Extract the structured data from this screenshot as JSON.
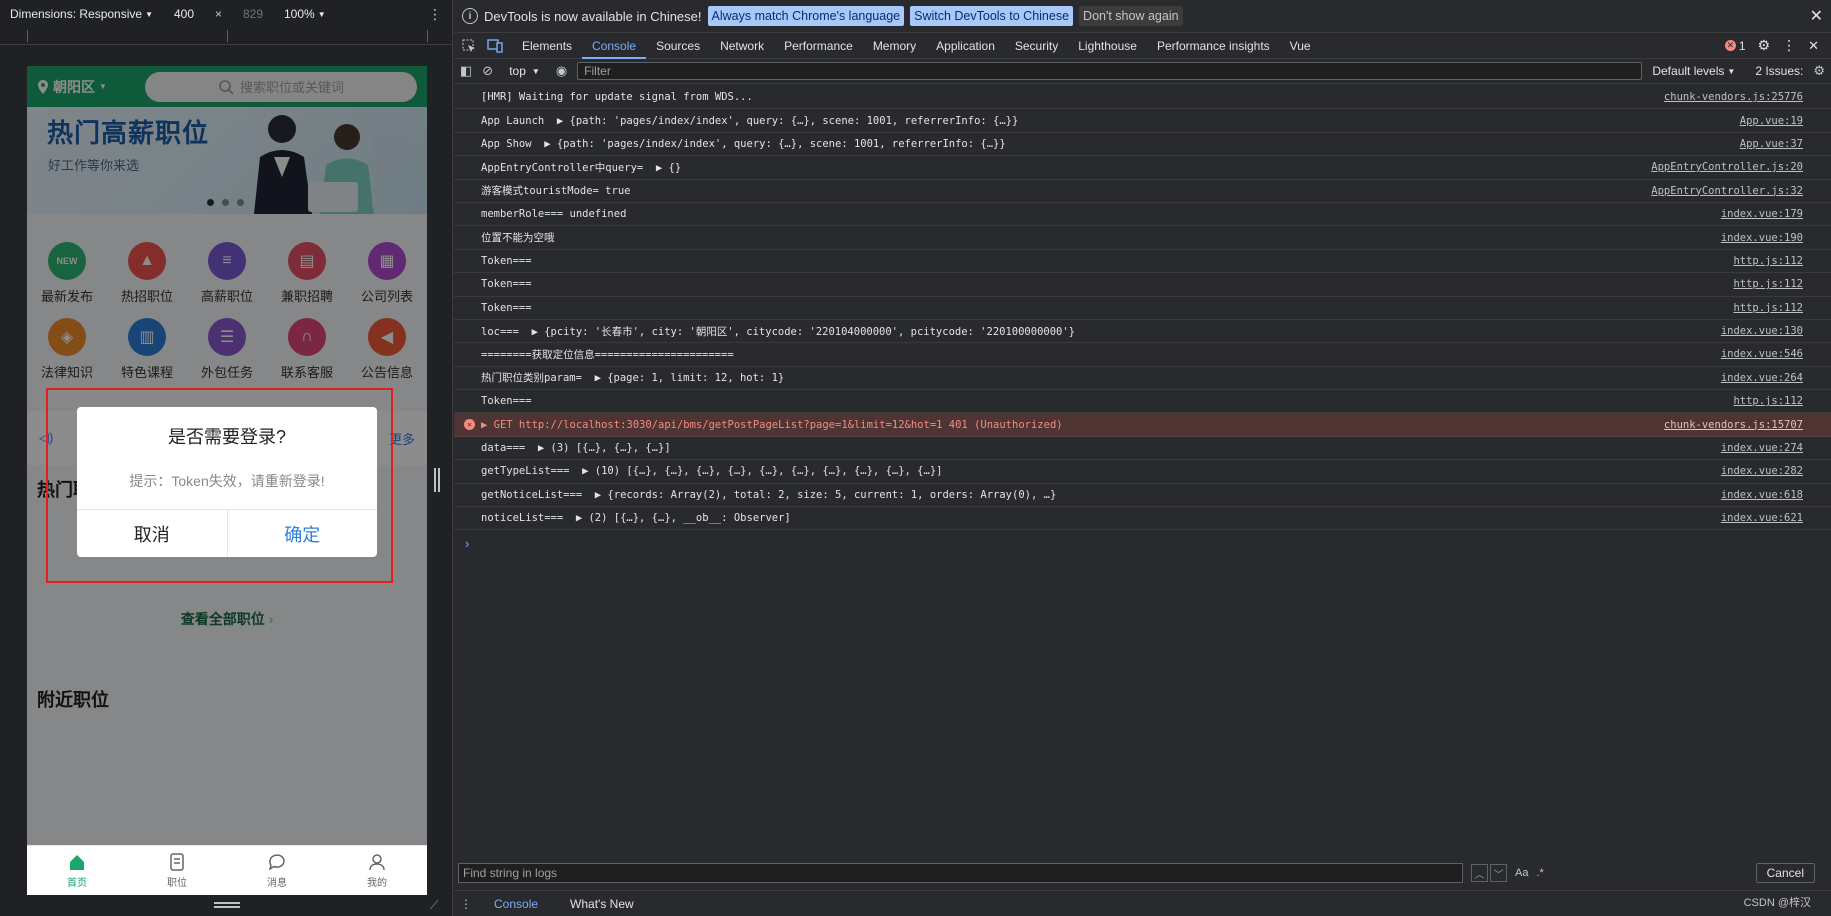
{
  "emulation": {
    "dimensions_label": "Dimensions: Responsive",
    "width": "400",
    "height": "829",
    "zoom": "100%"
  },
  "app": {
    "location": "朝阳区",
    "search_placeholder": "搜索职位或关键词",
    "banner_title": "热门高薪职位",
    "banner_subtitle": "好工作等你来选",
    "grid": [
      {
        "label": "最新发布",
        "icon": "new-icon",
        "color": "#2bb673",
        "glyph": "NEW"
      },
      {
        "label": "热招职位",
        "icon": "fire-icon",
        "color": "#f0544f",
        "glyph": "▲"
      },
      {
        "label": "高薪职位",
        "icon": "document-icon",
        "color": "#7a5ad8",
        "glyph": "≡"
      },
      {
        "label": "兼职招聘",
        "icon": "calendar-icon",
        "color": "#e8506a",
        "glyph": "▤"
      },
      {
        "label": "公司列表",
        "icon": "building-icon",
        "color": "#b04bd0",
        "glyph": "▦"
      },
      {
        "label": "法律知识",
        "icon": "layers-icon",
        "color": "#f08a2a",
        "glyph": "◈"
      },
      {
        "label": "特色课程",
        "icon": "book-icon",
        "color": "#2f7ed8",
        "glyph": "▥"
      },
      {
        "label": "外包任务",
        "icon": "checklist-icon",
        "color": "#8a5ad0",
        "glyph": "☰"
      },
      {
        "label": "联系客服",
        "icon": "headset-icon",
        "color": "#e0457a",
        "glyph": "∩"
      },
      {
        "label": "公告信息",
        "icon": "megaphone-icon",
        "color": "#f05a3a",
        "glyph": "◀"
      }
    ],
    "notice_more": "更多",
    "hot_section": "热门职位",
    "view_all": "查看全部职位",
    "nearby_section": "附近职位",
    "tabs": [
      {
        "label": "首页",
        "icon": "home-icon"
      },
      {
        "label": "职位",
        "icon": "list-icon"
      },
      {
        "label": "消息",
        "icon": "chat-icon"
      },
      {
        "label": "我的",
        "icon": "user-icon"
      }
    ],
    "dialog": {
      "title": "是否需要登录?",
      "message": "提示：Token失效，请重新登录!",
      "cancel": "取消",
      "confirm": "确定"
    }
  },
  "devtools": {
    "infobar": {
      "message": "DevTools is now available in Chinese!",
      "btn_match": "Always match Chrome's language",
      "btn_switch": "Switch DevTools to Chinese",
      "btn_dismiss": "Don't show again"
    },
    "tabs": [
      "Elements",
      "Console",
      "Sources",
      "Network",
      "Performance",
      "Memory",
      "Application",
      "Security",
      "Lighthouse",
      "Performance insights",
      "Vue"
    ],
    "active_tab": "Console",
    "error_count": "1",
    "context": "top",
    "filter_placeholder": "Filter",
    "levels": "Default levels",
    "issues": "2 Issues:",
    "logs": [
      {
        "text": "[HMR] Waiting for update signal from WDS...",
        "source": "chunk-vendors.js:25776",
        "error": false
      },
      {
        "text": "App Launch  ▶ {path: 'pages/index/index', query: {…}, scene: 1001, referrerInfo: {…}}",
        "source": "App.vue:19",
        "error": false
      },
      {
        "text": "App Show  ▶ {path: 'pages/index/index', query: {…}, scene: 1001, referrerInfo: {…}}",
        "source": "App.vue:37",
        "error": false
      },
      {
        "text": "AppEntryController中query=  ▶ {}",
        "source": "AppEntryController.js:20",
        "error": false
      },
      {
        "text": "游客模式touristMode= true",
        "source": "AppEntryController.js:32",
        "error": false
      },
      {
        "text": "memberRole=== undefined",
        "source": "index.vue:179",
        "error": false
      },
      {
        "text": "位置不能为空哦",
        "source": "index.vue:190",
        "error": false
      },
      {
        "text": "Token===",
        "source": "http.js:112",
        "error": false
      },
      {
        "text": "Token===",
        "source": "http.js:112",
        "error": false
      },
      {
        "text": "Token===",
        "source": "http.js:112",
        "error": false
      },
      {
        "text": "loc===  ▶ {pcity: '长春市', city: '朝阳区', citycode: '220104000000', pcitycode: '220100000000'}",
        "source": "index.vue:130",
        "error": false
      },
      {
        "text": "========获取定位信息======================",
        "source": "index.vue:546",
        "error": false
      },
      {
        "text": "热门职位类别param=  ▶ {page: 1, limit: 12, hot: 1}",
        "source": "index.vue:264",
        "error": false
      },
      {
        "text": "Token===",
        "source": "http.js:112",
        "error": false
      },
      {
        "text": "▶ GET http://localhost:3030/api/bms/getPostPageList?page=1&limit=12&hot=1 401 (Unauthorized)",
        "source": "chunk-vendors.js:15707",
        "error": true
      },
      {
        "text": "data===  ▶ (3) [{…}, {…}, {…}]",
        "source": "index.vue:274",
        "error": false
      },
      {
        "text": "getTypeList===  ▶ (10) [{…}, {…}, {…}, {…}, {…}, {…}, {…}, {…}, {…}, {…}]",
        "source": "index.vue:282",
        "error": false
      },
      {
        "text": "getNoticeList===  ▶ {records: Array(2), total: 2, size: 5, current: 1, orders: Array(0), …}",
        "source": "index.vue:618",
        "error": false
      },
      {
        "text": "noticeList===  ▶ (2) [{…}, {…}, __ob__: Observer]",
        "source": "index.vue:621",
        "error": false
      }
    ],
    "find_placeholder": "Find string in logs",
    "find_case": "Aa",
    "find_regex": ".*",
    "find_cancel": "Cancel",
    "drawer_tabs": [
      "Console",
      "What's New"
    ],
    "watermark": "CSDN @梓汉"
  }
}
